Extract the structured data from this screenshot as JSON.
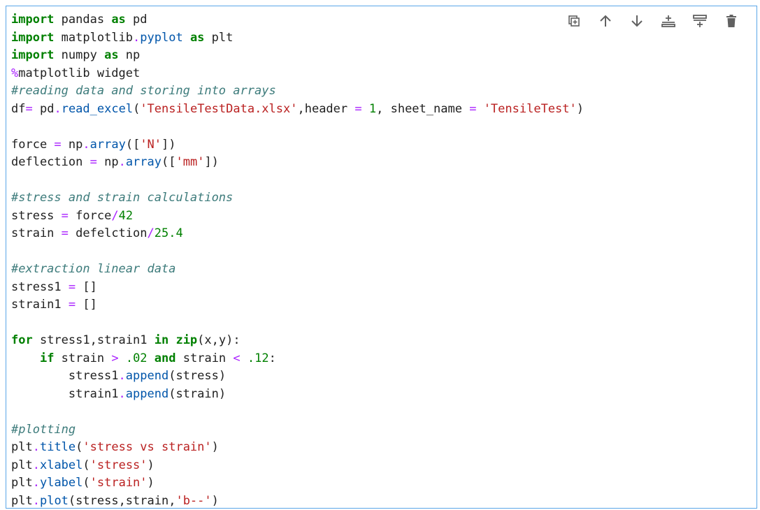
{
  "toolbar": {
    "buttons": [
      {
        "name": "duplicate-cell-button",
        "icon": "copy-icon"
      },
      {
        "name": "move-up-button",
        "icon": "arrow-up-icon"
      },
      {
        "name": "move-down-button",
        "icon": "arrow-down-icon"
      },
      {
        "name": "insert-above-button",
        "icon": "insert-above-icon"
      },
      {
        "name": "insert-below-button",
        "icon": "insert-below-icon"
      },
      {
        "name": "delete-cell-button",
        "icon": "trash-icon"
      }
    ],
    "icon_color": "#616161"
  },
  "colors": {
    "keyword": "#008000",
    "operator": "#aa22ff",
    "number": "#008000",
    "string": "#ba2121",
    "function": "#0055aa",
    "comment": "#3d7b7b",
    "text": "#212121",
    "cell_border": "#5aa6e8"
  },
  "code": {
    "lines": [
      [
        [
          "kw",
          "import"
        ],
        [
          "t",
          " pandas "
        ],
        [
          "kw",
          "as"
        ],
        [
          "t",
          " pd"
        ]
      ],
      [
        [
          "kw",
          "import"
        ],
        [
          "t",
          " matplotlib"
        ],
        [
          "op",
          "."
        ],
        [
          "fn",
          "pyplot"
        ],
        [
          "t",
          " "
        ],
        [
          "kw",
          "as"
        ],
        [
          "t",
          " plt"
        ]
      ],
      [
        [
          "kw",
          "import"
        ],
        [
          "t",
          " numpy "
        ],
        [
          "kw",
          "as"
        ],
        [
          "t",
          " np"
        ]
      ],
      [
        [
          "mg",
          "%"
        ],
        [
          "t",
          "matplotlib widget"
        ]
      ],
      [
        [
          "cm",
          "#reading data and storing into arrays"
        ]
      ],
      [
        [
          "t",
          "df"
        ],
        [
          "op",
          "="
        ],
        [
          "t",
          " pd"
        ],
        [
          "op",
          "."
        ],
        [
          "fn",
          "read_excel"
        ],
        [
          "t",
          "("
        ],
        [
          "str",
          "'TensileTestData.xlsx'"
        ],
        [
          "t",
          ",header "
        ],
        [
          "op",
          "="
        ],
        [
          "t",
          " "
        ],
        [
          "num",
          "1"
        ],
        [
          "t",
          ", sheet_name "
        ],
        [
          "op",
          "="
        ],
        [
          "t",
          " "
        ],
        [
          "str",
          "'TensileTest'"
        ],
        [
          "t",
          ")"
        ]
      ],
      [],
      [
        [
          "t",
          "force "
        ],
        [
          "op",
          "="
        ],
        [
          "t",
          " np"
        ],
        [
          "op",
          "."
        ],
        [
          "fn",
          "array"
        ],
        [
          "t",
          "(["
        ],
        [
          "str",
          "'N'"
        ],
        [
          "t",
          "])"
        ]
      ],
      [
        [
          "t",
          "deflection "
        ],
        [
          "op",
          "="
        ],
        [
          "t",
          " np"
        ],
        [
          "op",
          "."
        ],
        [
          "fn",
          "array"
        ],
        [
          "t",
          "(["
        ],
        [
          "str",
          "'mm'"
        ],
        [
          "t",
          "])"
        ]
      ],
      [],
      [
        [
          "cm",
          "#stress and strain calculations"
        ]
      ],
      [
        [
          "t",
          "stress "
        ],
        [
          "op",
          "="
        ],
        [
          "t",
          " force"
        ],
        [
          "op",
          "/"
        ],
        [
          "num",
          "42"
        ]
      ],
      [
        [
          "t",
          "strain "
        ],
        [
          "op",
          "="
        ],
        [
          "t",
          " defelction"
        ],
        [
          "op",
          "/"
        ],
        [
          "num",
          "25.4"
        ]
      ],
      [],
      [
        [
          "cm",
          "#extraction linear data"
        ]
      ],
      [
        [
          "t",
          "stress1 "
        ],
        [
          "op",
          "="
        ],
        [
          "t",
          " []"
        ]
      ],
      [
        [
          "t",
          "strain1 "
        ],
        [
          "op",
          "="
        ],
        [
          "t",
          " []"
        ]
      ],
      [],
      [
        [
          "kw",
          "for"
        ],
        [
          "t",
          " stress1,strain1 "
        ],
        [
          "kw",
          "in"
        ],
        [
          "t",
          " "
        ],
        [
          "kw",
          "zip"
        ],
        [
          "t",
          "(x,y):"
        ]
      ],
      [
        [
          "t",
          "    "
        ],
        [
          "kw",
          "if"
        ],
        [
          "t",
          " strain "
        ],
        [
          "op",
          ">"
        ],
        [
          "t",
          " "
        ],
        [
          "num",
          ".02"
        ],
        [
          "t",
          " "
        ],
        [
          "kw",
          "and"
        ],
        [
          "t",
          " strain "
        ],
        [
          "op",
          "<"
        ],
        [
          "t",
          " "
        ],
        [
          "num",
          ".12"
        ],
        [
          "t",
          ":"
        ]
      ],
      [
        [
          "t",
          "        stress1"
        ],
        [
          "op",
          "."
        ],
        [
          "fn",
          "append"
        ],
        [
          "t",
          "(stress)"
        ]
      ],
      [
        [
          "t",
          "        strain1"
        ],
        [
          "op",
          "."
        ],
        [
          "fn",
          "append"
        ],
        [
          "t",
          "(strain)"
        ]
      ],
      [],
      [
        [
          "cm",
          "#plotting"
        ]
      ],
      [
        [
          "t",
          "plt"
        ],
        [
          "op",
          "."
        ],
        [
          "fn",
          "title"
        ],
        [
          "t",
          "("
        ],
        [
          "str",
          "'stress vs strain'"
        ],
        [
          "t",
          ")"
        ]
      ],
      [
        [
          "t",
          "plt"
        ],
        [
          "op",
          "."
        ],
        [
          "fn",
          "xlabel"
        ],
        [
          "t",
          "("
        ],
        [
          "str",
          "'stress'"
        ],
        [
          "t",
          ")"
        ]
      ],
      [
        [
          "t",
          "plt"
        ],
        [
          "op",
          "."
        ],
        [
          "fn",
          "ylabel"
        ],
        [
          "t",
          "("
        ],
        [
          "str",
          "'strain'"
        ],
        [
          "t",
          ")"
        ]
      ],
      [
        [
          "t",
          "plt"
        ],
        [
          "op",
          "."
        ],
        [
          "fn",
          "plot"
        ],
        [
          "t",
          "(stress,strain,"
        ],
        [
          "str",
          "'b--'"
        ],
        [
          "t",
          ")"
        ]
      ]
    ]
  }
}
